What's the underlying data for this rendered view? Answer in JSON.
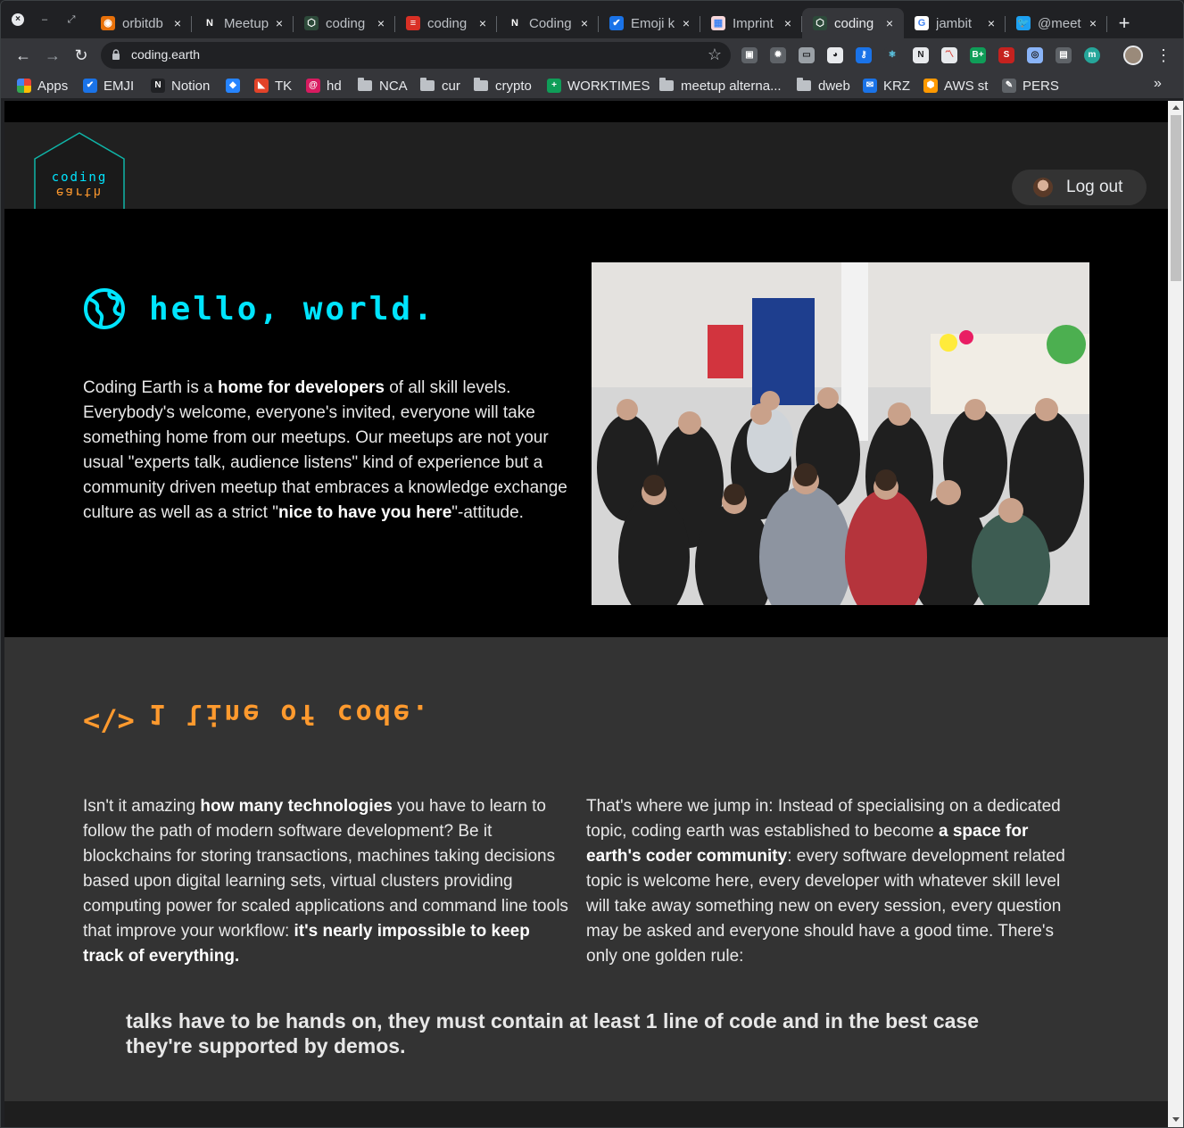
{
  "browser": {
    "tabs": [
      {
        "title": "orbitdb",
        "fav_color": "#e8710a",
        "fav_glyph": "◉"
      },
      {
        "title": "Meetup",
        "fav_color": "#202124",
        "fav_glyph": "N"
      },
      {
        "title": "coding",
        "fav_color": "#2d4a3a",
        "fav_glyph": "⬡"
      },
      {
        "title": "coding",
        "fav_color": "#d93025",
        "fav_glyph": "≡"
      },
      {
        "title": "Coding",
        "fav_color": "#202124",
        "fav_glyph": "N"
      },
      {
        "title": "Emoji k",
        "fav_color": "#1a73e8",
        "fav_glyph": "✔"
      },
      {
        "title": "Imprint",
        "fav_color": "#f8d7da",
        "fav_glyph": "▦"
      },
      {
        "title": "coding",
        "fav_color": "#2d4a3a",
        "fav_glyph": "⬡",
        "active": true
      },
      {
        "title": "jambit",
        "fav_color": "#ffffff",
        "fav_glyph": "G"
      },
      {
        "title": "@meet",
        "fav_color": "#1da1f2",
        "fav_glyph": "🐦"
      }
    ],
    "url": "coding.earth",
    "bookmarks": [
      {
        "label": "Apps",
        "type": "apps"
      },
      {
        "label": "EMJI",
        "type": "icon",
        "color": "#1a73e8",
        "glyph": "✔"
      },
      {
        "label": "Notion",
        "type": "icon",
        "color": "#202124",
        "glyph": "N"
      },
      {
        "label": "",
        "type": "icon",
        "color": "#2684ff",
        "glyph": "◆"
      },
      {
        "label": "TK",
        "type": "icon",
        "color": "#e24329",
        "glyph": "◣"
      },
      {
        "label": "hd",
        "type": "icon",
        "color": "#d81b60",
        "glyph": "@"
      },
      {
        "label": "NCA",
        "type": "folder"
      },
      {
        "label": "cur",
        "type": "folder"
      },
      {
        "label": "crypto",
        "type": "folder"
      },
      {
        "label": "WORKTIMES",
        "type": "icon",
        "color": "#0f9d58",
        "glyph": "+"
      },
      {
        "label": "meetup alterna...",
        "type": "folder"
      },
      {
        "label": "dweb",
        "type": "folder"
      },
      {
        "label": "KRZ",
        "type": "icon",
        "color": "#1a73e8",
        "glyph": "✉"
      },
      {
        "label": "AWS st",
        "type": "icon",
        "color": "#ff9900",
        "glyph": "⬢"
      },
      {
        "label": "PERS",
        "type": "icon",
        "color": "#5f6368",
        "glyph": "✎"
      }
    ],
    "more_label": "»"
  },
  "site": {
    "logo_top": "coding",
    "logo_bottom": "earth",
    "logout_label": "Log out",
    "hero": {
      "title": "hello, world.",
      "p1_a": "Coding Earth is a ",
      "p1_b": "home for developers",
      "p1_c": " of all skill levels. Everybody's welcome, everyone's invited, everyone will take something home from our meetups. Our meetups are not your usual \"experts talk, audience listens\" kind of experience but a community driven meetup that embraces a knowledge exchange culture as well as a strict \"",
      "p1_d": "nice to have you here",
      "p1_e": "\"-attitude."
    },
    "section": {
      "icon": "</>",
      "title": "1 line of code.",
      "left_a": "Isn't it amazing ",
      "left_b": "how many technologies",
      "left_c": " you have to learn to follow the path of modern software development? Be it blockchains for storing transactions, machines taking decisions based upon digital learning sets, virtual clusters providing computing power for scaled applications and command line tools that improve your workflow: ",
      "left_d": "it's nearly impossible to keep track of everything.",
      "right_a": "That's where we jump in: Instead of specialising on a dedicated topic, coding earth was established to become ",
      "right_b": "a space for earth's coder community",
      "right_c": ": every software development related topic is welcome here, every developer with whatever skill level will take away something new on every session, every question may be asked and everyone should have a good time. There's only one golden rule:",
      "rule": "talks have to be hands on, they must contain at least 1 line of code and in the best case they're supported by demos."
    },
    "colors": {
      "accent_cyan": "#00e5ff",
      "accent_orange": "#ff9a2e",
      "hero_bg": "#000000",
      "section_bg": "#333333"
    }
  }
}
